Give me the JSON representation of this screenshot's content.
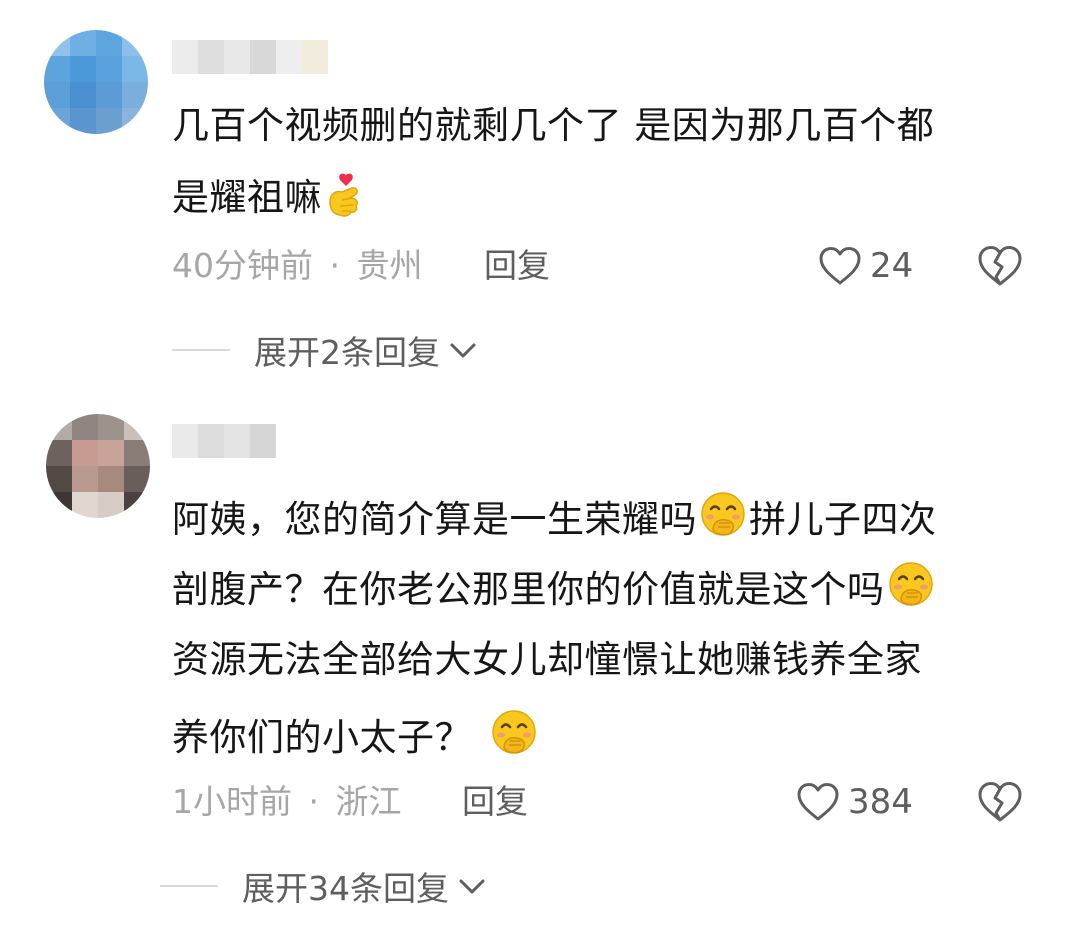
{
  "comments": [
    {
      "text_lines": [
        "几百个视频删的就剩几个了 是因为那几百个都",
        "是耀祖嘛"
      ],
      "line_end_emoji": "finger-heart-emoji",
      "time": "40分钟前",
      "separator": "·",
      "location": "贵州",
      "reply_label": "回复",
      "like_count": "24",
      "expand_label": "展开2条回复"
    },
    {
      "text_lines": [
        "阿姨，您的简介算是一生荣耀吗",
        "拼儿子四次",
        "剖腹产？在你老公那里你的价值就是这个吗",
        "资源无法全部给大女儿却憧憬让她赚钱养全家",
        "养你们的小太子？"
      ],
      "emoji": "hand-over-mouth-emoji",
      "time": "1小时前",
      "separator": "·",
      "location": "浙江",
      "reply_label": "回复",
      "like_count": "384",
      "expand_label": "展开34条回复"
    }
  ],
  "icons": {
    "like": "heart-outline-icon",
    "dislike": "broken-heart-icon",
    "expand": "chevron-down-icon"
  },
  "colors": {
    "text": "#161616",
    "meta": "#a6a6a6",
    "action": "#5e5e5e",
    "emoji_face": "#f8c81e",
    "heart": "#f0304a"
  }
}
